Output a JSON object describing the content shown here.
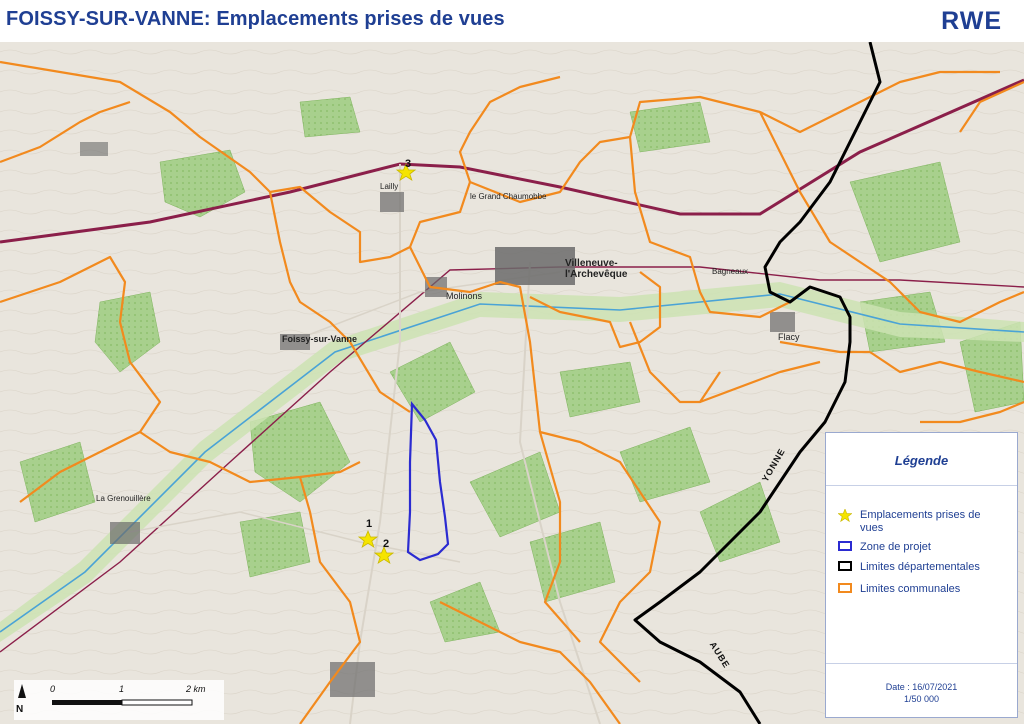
{
  "header": {
    "title": "FOISSY-SUR-VANNE: Emplacements prises de vues",
    "logo": "RWE"
  },
  "map": {
    "places": [
      {
        "name": "Foissy-sur-Vanne"
      },
      {
        "name": "Villeneuve-l'Archevêque"
      },
      {
        "name": "Molinons"
      },
      {
        "name": "Flacy"
      },
      {
        "name": "Bagneaux"
      },
      {
        "name": "La Grenouillère"
      },
      {
        "name": "le Grand Chaumobbe"
      },
      {
        "name": "Lailly"
      }
    ],
    "viewpoints": [
      {
        "label": "1"
      },
      {
        "label": "2"
      },
      {
        "label": "3"
      }
    ],
    "department_labels": [
      {
        "text": "YONNE"
      },
      {
        "text": "AUBE"
      }
    ]
  },
  "legend": {
    "title": "Légende",
    "items": [
      {
        "label": "Emplacements prises de vues",
        "color": "#f5e400"
      },
      {
        "label": "Zone de projet",
        "color": "#2b2bd1"
      },
      {
        "label": "Limites départementales",
        "color": "#000000"
      },
      {
        "label": "Limites communales",
        "color": "#f28a1e"
      }
    ],
    "date_label": "Date : 16/07/2021",
    "scale": "1/50 000"
  },
  "scalebar": {
    "labels": [
      "0",
      "1",
      "2 km"
    ],
    "north": "N"
  }
}
